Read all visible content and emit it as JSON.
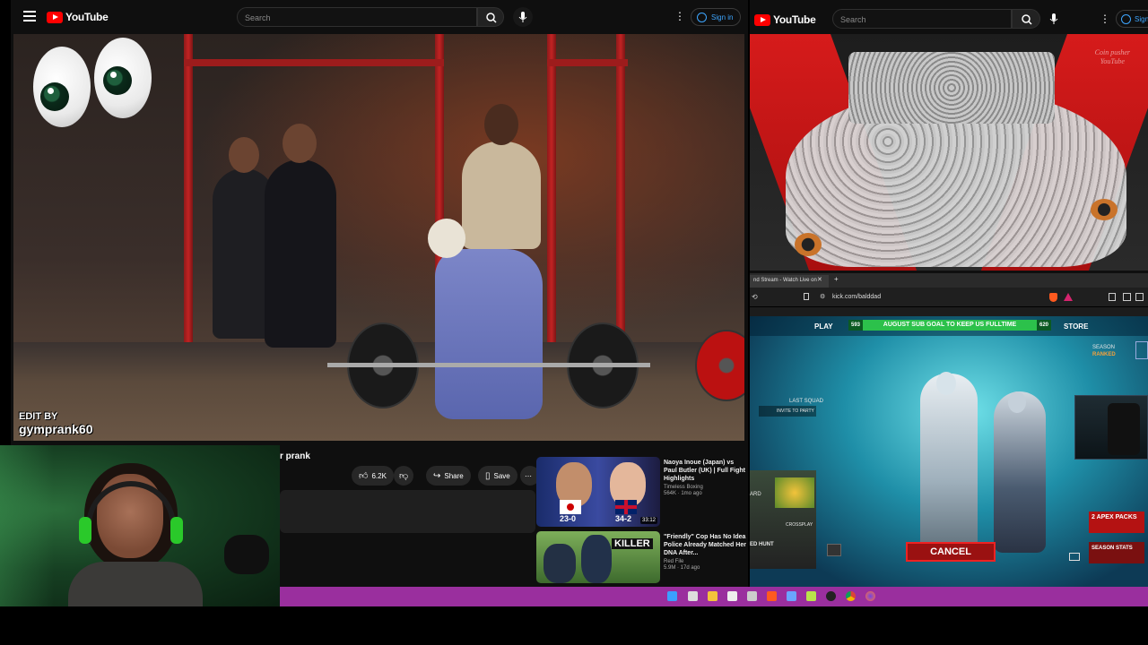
{
  "left_youtube": {
    "logo_text": "YouTube",
    "search_placeholder": "Search",
    "sign_in_label": "Sign in",
    "overlay_edit_by": "EDIT BY",
    "overlay_handle": "gymprank60",
    "video_title_partial": "r prank",
    "actions": {
      "like_count": "6.2K",
      "share_label": "Share",
      "save_label": "Save"
    },
    "recommendations": [
      {
        "title": "Naoya Inoue (Japan) vs Paul Butler (UK) | Full Fight Highlights",
        "channel": "Timeless Boxing",
        "meta": "564K · 1mo ago",
        "duration": "33:12",
        "score_left": "23-0",
        "score_right": "34-2"
      },
      {
        "title": "\"Friendly\" Cop Has No Idea Police Already Matched Her DNA After...",
        "channel": "Red File",
        "meta": "5.9M · 17d ago",
        "thumb_text": "KILLER"
      }
    ]
  },
  "right_youtube": {
    "logo_text": "YouTube",
    "search_placeholder": "Search",
    "sign_in_label": "Sign",
    "watermark_line1": "Coin pusher",
    "watermark_line2": "YouTube"
  },
  "kick_browser": {
    "tab_title": "nd Stream - Watch Live on",
    "url": "kick.com/balddad",
    "apex": {
      "play_label": "PLAY",
      "store_label": "STORE",
      "goal_text": "AUGUST SUB GOAL TO KEEP US FULLTIME",
      "goal_current": "593",
      "goal_target": "620",
      "season_label": "SEASON",
      "season_rank": "RANKED",
      "last_squad_label": "LAST SQUAD",
      "invite_label": "INVITE TO PARTY",
      "cancel_label": "CANCEL",
      "packs_label": "2 APEX PACKS",
      "season_stats_label": "SEASON STATS",
      "crossplay_label": "CROSSPLAY",
      "hunt_label": "ED HUNT",
      "squad_tag": "ARD"
    }
  }
}
